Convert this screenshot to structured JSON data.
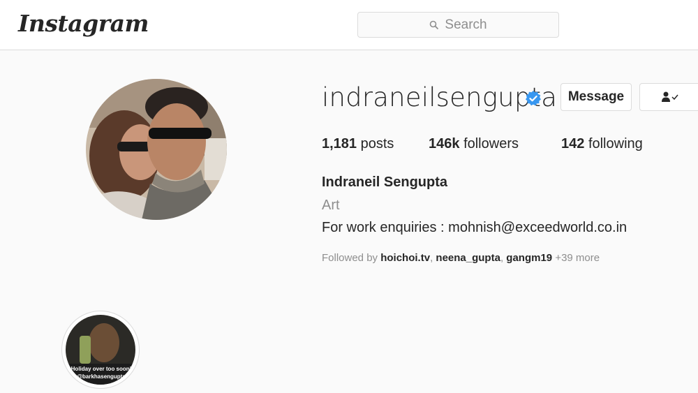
{
  "header": {
    "logo": "Instagram",
    "search_placeholder": "Search"
  },
  "profile": {
    "username": "indraneilsengupta",
    "verified": true,
    "message_button": "Message",
    "stats": {
      "posts_count": "1,181",
      "posts_label": "posts",
      "followers_count": "146k",
      "followers_label": "followers",
      "following_count": "142",
      "following_label": "following"
    },
    "full_name": "Indraneil Sengupta",
    "category": "Art",
    "bio": "For work enquiries : mohnish@exceedworld.co.in",
    "followed_by": {
      "prefix": "Followed by",
      "users": [
        "hoichoi.tv",
        "neena_gupta",
        "gangm19"
      ],
      "more": "+39 more"
    }
  },
  "highlights": [
    {
      "overlay_line1": "Holiday over too soon!",
      "overlay_line2": "@barkhasengupta"
    }
  ],
  "colors": {
    "verified_badge": "#3897f0",
    "border": "#dbdbdb",
    "muted_text": "#8e8e8e"
  },
  "icons": [
    "search-icon",
    "verified-badge-icon",
    "person-check-icon"
  ]
}
